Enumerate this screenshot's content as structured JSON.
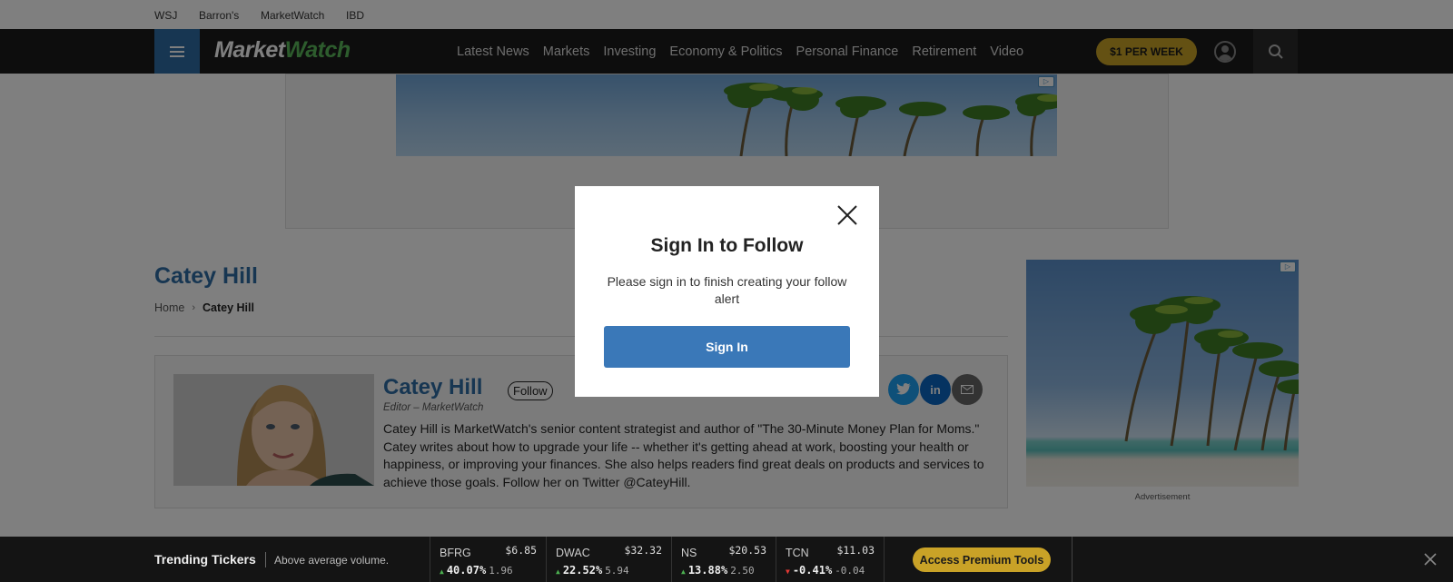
{
  "topbar": {
    "links": [
      "WSJ",
      "Barron's",
      "MarketWatch",
      "IBD"
    ]
  },
  "nav": {
    "logo_market": "Market",
    "logo_watch": "Watch",
    "items": [
      "Latest News",
      "Markets",
      "Investing",
      "Economy & Politics",
      "Personal Finance",
      "Retirement",
      "Video"
    ],
    "subscribe_label": "$1 PER WEEK",
    "hamburger_icon": "hamburger-icon",
    "user_icon": "user-icon",
    "search_icon": "search-icon"
  },
  "author": {
    "name": "Catey Hill",
    "breadcrumb": {
      "home": "Home",
      "current": "Catey Hill"
    }
  },
  "bio": {
    "name": "Catey Hill",
    "follow_label": "Follow",
    "role": "Editor – MarketWatch",
    "text": "Catey Hill is MarketWatch's senior content strategist and author of \"The 30-Minute Money Plan for Moms.\" Catey writes about how to upgrade your life -- whether it's getting ahead at work, boosting your health or happiness, or improving your finances. She also helps readers find great deals on products and services to achieve those goals. Follow her on Twitter @CateyHill.",
    "social": [
      {
        "icon": "twitter-icon",
        "color": "#1da1f2"
      },
      {
        "icon": "linkedin-icon",
        "color": "#0a66c2"
      },
      {
        "icon": "email-icon",
        "color": "#666666"
      }
    ]
  },
  "ads": {
    "label": "Advertisement"
  },
  "modal": {
    "title": "Sign In to Follow",
    "message": "Please sign in to finish creating your follow alert",
    "button_label": "Sign In",
    "close_icon": "close-icon"
  },
  "ticker_bar": {
    "title": "Trending Tickers",
    "subtitle": "Above average volume.",
    "tickers": [
      {
        "symbol": "BFRG",
        "price": "$6.85",
        "pct": "40.07%",
        "change": "1.96",
        "direction": "up"
      },
      {
        "symbol": "DWAC",
        "price": "$32.32",
        "pct": "22.52%",
        "change": "5.94",
        "direction": "up"
      },
      {
        "symbol": "NS",
        "price": "$20.53",
        "pct": "13.88%",
        "change": "2.50",
        "direction": "up"
      },
      {
        "symbol": "TCN",
        "price": "$11.03",
        "pct": "-0.41%",
        "change": "-0.04",
        "direction": "down"
      }
    ],
    "premium_label": "Access Premium Tools",
    "up_color": "#4caf50",
    "down_color": "#e53935"
  },
  "colors": {
    "brand_blue": "#2e6da4",
    "gold": "#c9a227",
    "nav_bg": "#1a1a1a"
  }
}
